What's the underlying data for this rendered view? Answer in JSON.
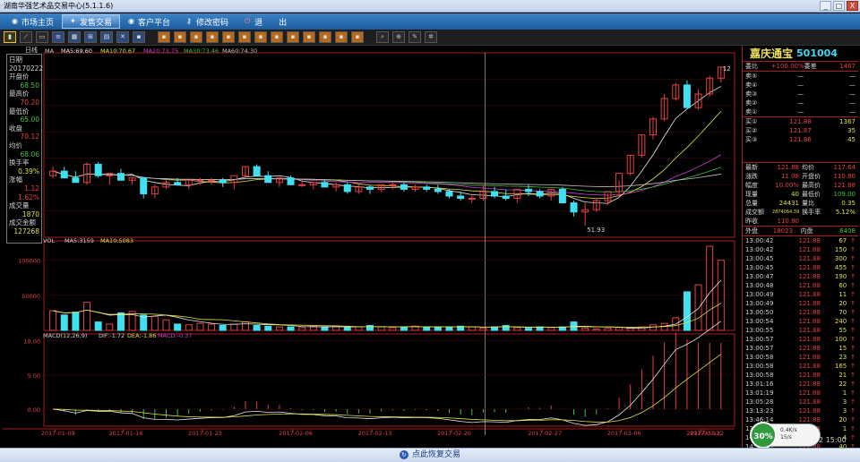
{
  "window": {
    "title": "湖南华强艺术品交易中心(5.1.1.6)",
    "min": "_",
    "max": "□",
    "close": "X"
  },
  "nav": [
    {
      "label": "市场主页",
      "icon": "home-icon",
      "active": false
    },
    {
      "label": "发售交易",
      "icon": "trade-icon",
      "active": true
    },
    {
      "label": "客户平台",
      "icon": "client-icon",
      "active": false
    },
    {
      "label": "修改密码",
      "icon": "key-icon",
      "active": false
    },
    {
      "label": "退",
      "icon": "exit-icon",
      "active": false
    },
    {
      "label": "出",
      "icon": "",
      "active": false
    }
  ],
  "toolbar_icons": [
    "candle-chart-icon",
    "line-chart-icon",
    "chart-flat-icon",
    "stock-list-icon",
    "grid-icon",
    "zoom-grid-icon",
    "table-icon",
    "cross-icon",
    "tool-icon",
    "tool-icon",
    "tool-icon",
    "tool-icon",
    "tool-icon",
    "tool-icon",
    "tool-icon",
    "tool-icon",
    "tool-icon",
    "tool-icon",
    "tool-icon",
    "tool-icon",
    "tool-icon",
    "tool-icon",
    "search-icon",
    "search-plus-icon",
    "draw-icon",
    "gear-icon"
  ],
  "chart_header": {
    "period": "日线",
    "ma_label": "MA",
    "ma5": "MA5:69.60",
    "ma10": "MA10:70.67",
    "ma20": "MA20:73.75",
    "ma30": "MA30:73.46",
    "ma60": "MA60:74.30"
  },
  "vol_header": {
    "label": "VOL",
    "ma5": "MA5:3159",
    "ma10": "MA10:5083"
  },
  "macd_header": {
    "label": "MACD(12,26,9)",
    "dif": "DIF:-1.72",
    "dea": "DEA:-1.86",
    "macd": "MACD:-0.37"
  },
  "info": {
    "date_label": "日期",
    "date": "20170222",
    "open_label": "开盘价",
    "open": "68.50",
    "high_label": "最高价",
    "high": "70.20",
    "low_label": "最低价",
    "low": "65.00",
    "close_label": "收盘",
    "close": "70.12",
    "avg_label": "均价",
    "avg": "68.06",
    "turnover_label": "换手率",
    "turnover": "0.39%",
    "chg_label": "涨幅",
    "chg": "1.12",
    "chg_pct": "1.62%",
    "vol_label": "成交量",
    "vol": "1870",
    "amt_label": "成交金额",
    "amt": "127268"
  },
  "price_labels": {
    "high": "12",
    "low": "51.93"
  },
  "quote": {
    "name": "嘉庆通宝",
    "code": "501004",
    "weibi_label": "委比",
    "weibi": "+100.00%",
    "weicha_label": "委差",
    "weicha": "1467",
    "sells": [
      {
        "label": "卖⑤",
        "price": "—",
        "vol": "—"
      },
      {
        "label": "卖④",
        "price": "—",
        "vol": "—"
      },
      {
        "label": "卖③",
        "price": "—",
        "vol": "—"
      },
      {
        "label": "卖②",
        "price": "—",
        "vol": "—"
      },
      {
        "label": "卖①",
        "price": "—",
        "vol": "—"
      }
    ],
    "buys": [
      {
        "label": "买①",
        "price": "121.88",
        "vol": "1367"
      },
      {
        "label": "买②",
        "price": "121.87",
        "vol": "35"
      },
      {
        "label": "买③",
        "price": "121.86",
        "vol": "45"
      }
    ],
    "stats": [
      [
        "最新",
        "121.88",
        "均价",
        "117.64"
      ],
      [
        "涨跌",
        "11.08",
        "开盘价",
        "110.80"
      ],
      [
        "幅度",
        "10.00%",
        "最高价",
        "121.88"
      ],
      [
        "现量",
        "40",
        "最低价",
        "109.00"
      ],
      [
        "总量",
        "24431",
        "量比",
        "0.35"
      ],
      [
        "成交额",
        "2874064.39",
        "换手率",
        "5.12%"
      ],
      [
        "昨收",
        "110.80",
        "",
        ""
      ]
    ],
    "outer_label": "外盘",
    "outer": "18023",
    "inner_label": "内盘",
    "inner": "6408"
  },
  "ticks": [
    [
      "13:00:42",
      "121.88",
      "67",
      "↑"
    ],
    [
      "13:00:42",
      "121.88",
      "150",
      "↑"
    ],
    [
      "13:00:45",
      "121.88",
      "300",
      "↑"
    ],
    [
      "13:00:45",
      "121.88",
      "455",
      "↑"
    ],
    [
      "13:00:47",
      "121.88",
      "190",
      "↑"
    ],
    [
      "13:00:48",
      "121.88",
      "60",
      "↑"
    ],
    [
      "13:00:49",
      "121.88",
      "11",
      "↑"
    ],
    [
      "13:00:49",
      "121.88",
      "20",
      "↑"
    ],
    [
      "13:00:50",
      "121.88",
      "70",
      "↑"
    ],
    [
      "13:00:54",
      "121.88",
      "240",
      "↑"
    ],
    [
      "13:00:55",
      "121.88",
      "55",
      "↑"
    ],
    [
      "13:00:57",
      "121.88",
      "100",
      "↑"
    ],
    [
      "13:00:57",
      "121.88",
      "15",
      "↑"
    ],
    [
      "13:00:58",
      "121.88",
      "23",
      "↑"
    ],
    [
      "13:00:58",
      "121.88",
      "165",
      "↑"
    ],
    [
      "13:00:58",
      "121.88",
      "21",
      "↑"
    ],
    [
      "13:01:16",
      "121.88",
      "22",
      "↑"
    ],
    [
      "13:01:19",
      "121.88",
      "1",
      "↑"
    ],
    [
      "13:05:28",
      "121.88",
      "3",
      "↑"
    ],
    [
      "13:13:23",
      "121.88",
      "3",
      "↑"
    ],
    [
      "13:46:14",
      "121.88",
      "20",
      "↑"
    ],
    [
      "13:58:37",
      "121.88",
      "1",
      "↑"
    ],
    [
      "14:22:09",
      "121.88",
      "4",
      "↑"
    ],
    [
      "14:39:51",
      "121.88",
      "40",
      "↑"
    ]
  ],
  "status": {
    "text": "点此恢复交易",
    "time": "2 15:00"
  },
  "widget": {
    "pct": "30%",
    "line1": "0.4K/s",
    "line2": "15/s"
  },
  "chart_data": {
    "type": "candlestick",
    "dates": [
      "2017-01-09",
      "2017-01-16",
      "2017-01-23",
      "2017-02-06",
      "2017-02-13",
      "2017-02-20",
      "2017-02-27",
      "2017-03-06",
      "2017-03-13",
      "2017-03-22"
    ],
    "ylim": [
      50,
      125
    ],
    "candles": [
      [
        74,
        78,
        73,
        76
      ],
      [
        76,
        78,
        74,
        73
      ],
      [
        73,
        76,
        72,
        71
      ],
      [
        71,
        80,
        70,
        79
      ],
      [
        79,
        80,
        73,
        74
      ],
      [
        74,
        75,
        70,
        75
      ],
      [
        75,
        77,
        72,
        72
      ],
      [
        72,
        73,
        70,
        73
      ],
      [
        73,
        73,
        64,
        66
      ],
      [
        66,
        70,
        64,
        69
      ],
      [
        69,
        72,
        68,
        71
      ],
      [
        71,
        73,
        70,
        70
      ],
      [
        70,
        72,
        68,
        72
      ],
      [
        72,
        73,
        70,
        72
      ],
      [
        72,
        73,
        70,
        72
      ],
      [
        72,
        73,
        69,
        71
      ],
      [
        71,
        72,
        68,
        74
      ],
      [
        74,
        78,
        73,
        78
      ],
      [
        78,
        79,
        74,
        74
      ],
      [
        74,
        76,
        71,
        71
      ],
      [
        71,
        73,
        69,
        73
      ],
      [
        73,
        74,
        71,
        70
      ],
      [
        70,
        72,
        69,
        70
      ],
      [
        70,
        71,
        68,
        71
      ],
      [
        71,
        72,
        69,
        69
      ],
      [
        69,
        71,
        67,
        70
      ],
      [
        70,
        71,
        66,
        67
      ],
      [
        67,
        70,
        66,
        69
      ],
      [
        69,
        70,
        66,
        68
      ],
      [
        68,
        70,
        67,
        70
      ],
      [
        70,
        71,
        68,
        70
      ],
      [
        70,
        71,
        67,
        68
      ],
      [
        68,
        70,
        67,
        69
      ],
      [
        69,
        70,
        67,
        68
      ],
      [
        68,
        70,
        66,
        67
      ],
      [
        67,
        68,
        64,
        65
      ],
      [
        65,
        67,
        63,
        64
      ],
      [
        64,
        66,
        62,
        64
      ],
      [
        64,
        70,
        63,
        67
      ],
      [
        67,
        69,
        64,
        65
      ],
      [
        65,
        68,
        63,
        64
      ],
      [
        64,
        66,
        62,
        68
      ],
      [
        68,
        70,
        65,
        67
      ],
      [
        67,
        68,
        64,
        65
      ],
      [
        65,
        67,
        63,
        68
      ],
      [
        68,
        69,
        64,
        62
      ],
      [
        62,
        63,
        56,
        58
      ],
      [
        58,
        62,
        51.93,
        59
      ],
      [
        59,
        64,
        58,
        63
      ],
      [
        63,
        66,
        61,
        67
      ],
      [
        67,
        72,
        64,
        75
      ],
      [
        75,
        83,
        74,
        83
      ],
      [
        83,
        92,
        82,
        92
      ],
      [
        92,
        100,
        90,
        99
      ],
      [
        99,
        110,
        98,
        108
      ],
      [
        108,
        115,
        107,
        114
      ],
      [
        114,
        116,
        104,
        104
      ],
      [
        104,
        112,
        103,
        110
      ],
      [
        110,
        118,
        109,
        117
      ],
      [
        117,
        122,
        115,
        121.88
      ]
    ],
    "volume": {
      "ylim": [
        0,
        120000
      ],
      "ticks": [
        50000,
        100000
      ],
      "values": [
        28000,
        22000,
        26000,
        40000,
        12000,
        9000,
        25000,
        27000,
        22000,
        20000,
        15000,
        9000,
        8000,
        10000,
        9000,
        7000,
        9000,
        12000,
        7000,
        6000,
        5000,
        5000,
        4000,
        6000,
        5000,
        6000,
        4000,
        5000,
        7000,
        5000,
        4000,
        5000,
        6000,
        5000,
        5000,
        4000,
        6000,
        5000,
        3000,
        5000,
        7000,
        4000,
        3000,
        5000,
        4000,
        5000,
        12000,
        3000,
        2000,
        3000,
        4000,
        3000,
        5000,
        8000,
        10000,
        18000,
        55000,
        65000,
        120000,
        100000,
        20000
      ]
    },
    "macd": {
      "ylim": [
        -2.5,
        11
      ],
      "ticks": [
        0.0,
        5.0,
        10.0
      ]
    }
  }
}
